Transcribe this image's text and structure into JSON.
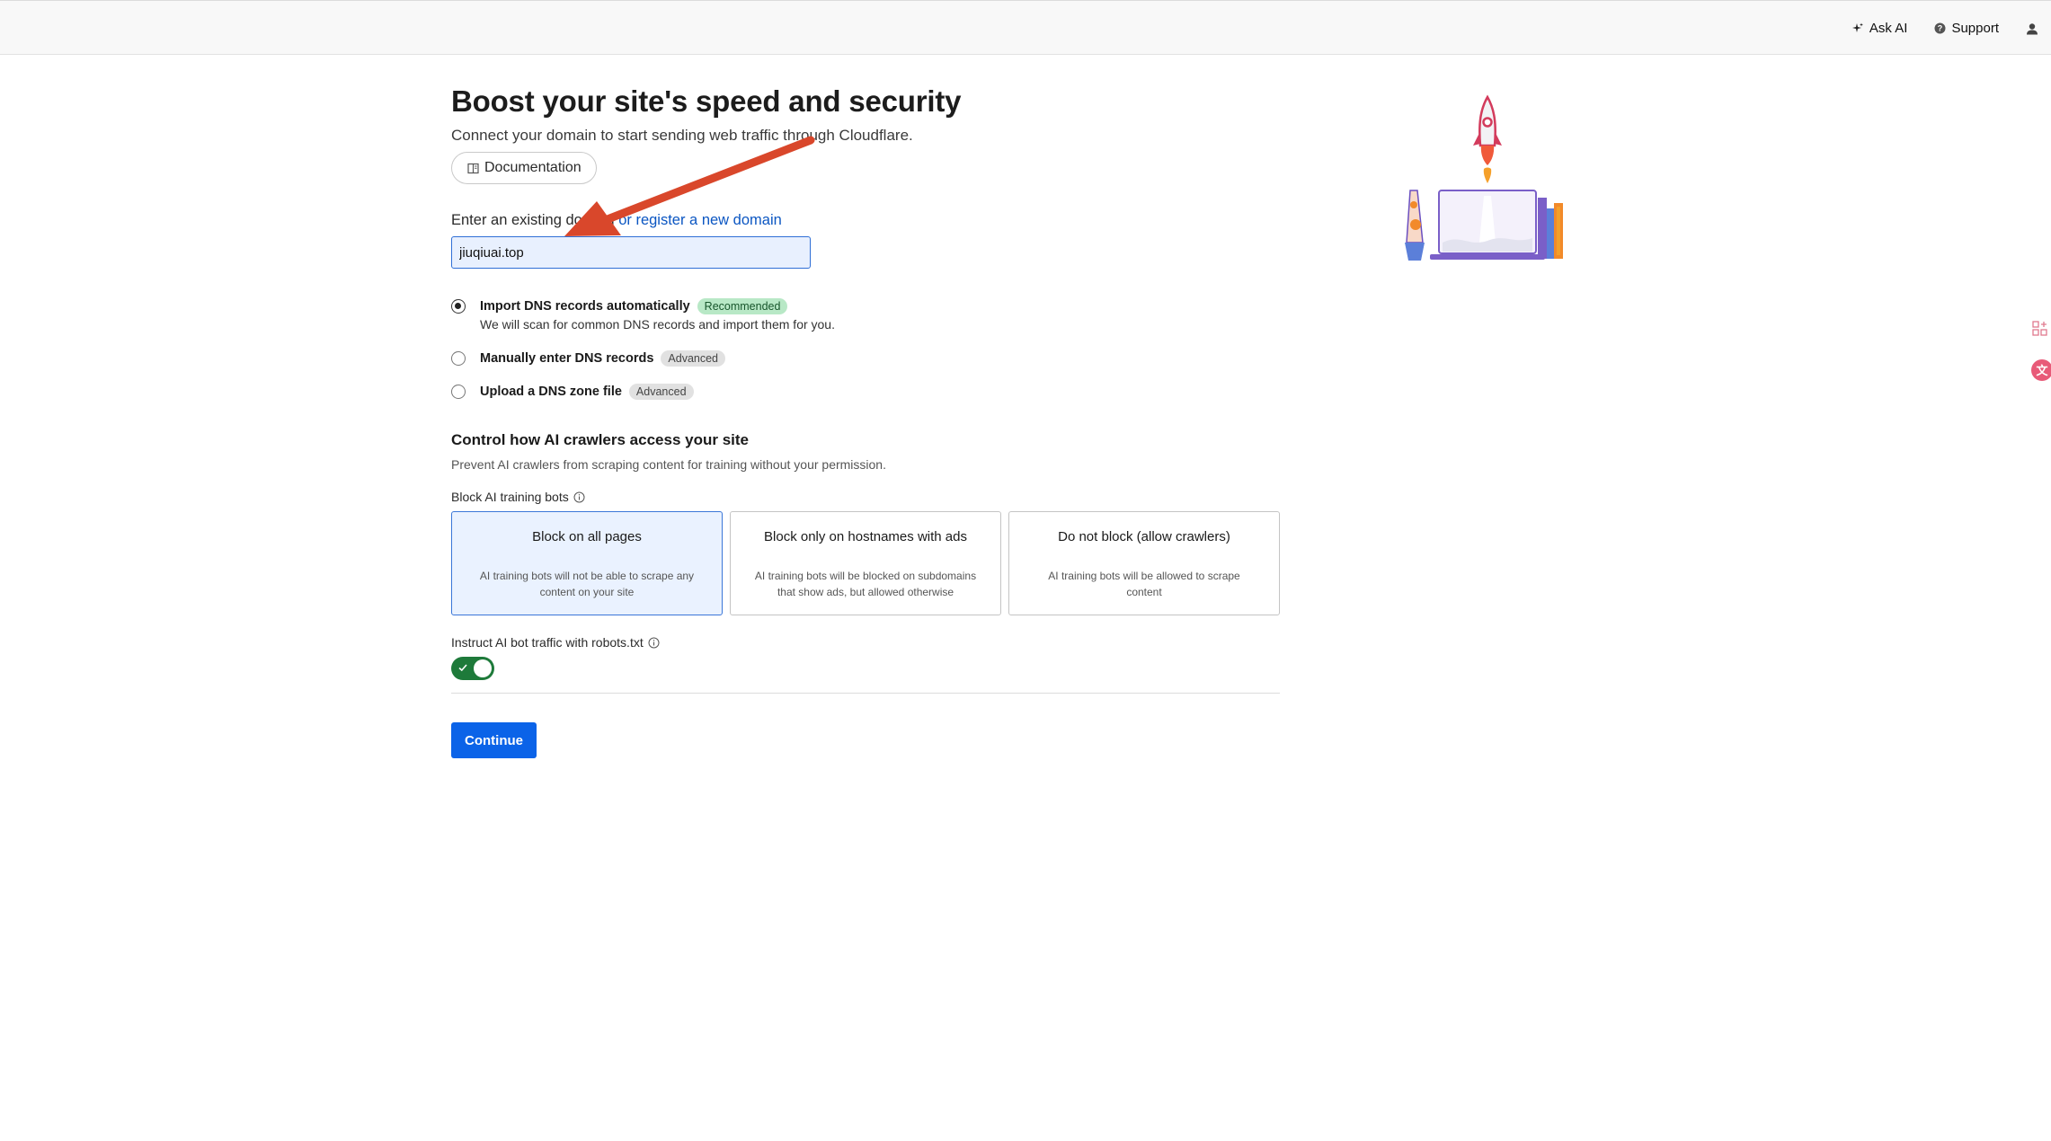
{
  "topbar": {
    "ask_ai": "Ask AI",
    "support": "Support"
  },
  "main": {
    "title": "Boost your site's speed and security",
    "subtitle": "Connect your domain to start sending web traffic through Cloudflare.",
    "documentation_label": "Documentation",
    "domain_label_prefix": "Enter an existing domain",
    "domain_label_link": "or register a new domain",
    "domain_value": "jiuqiuai.top"
  },
  "dns_options": [
    {
      "label": "Import DNS records automatically",
      "badge": "Recommended",
      "checked": true,
      "description": "We will scan for common DNS records and import them for you."
    },
    {
      "label": "Manually enter DNS records",
      "badge": "Advanced",
      "checked": false
    },
    {
      "label": "Upload a DNS zone file",
      "badge": "Advanced",
      "checked": false
    }
  ],
  "ai_section": {
    "title": "Control how AI crawlers access your site",
    "description": "Prevent AI crawlers from scraping content for training without your permission.",
    "block_label": "Block AI training bots",
    "cards": [
      {
        "title": "Block on all pages",
        "description": "AI training bots will not be able to scrape any content on your site",
        "selected": true
      },
      {
        "title": "Block only on hostnames with ads",
        "description": "AI training bots will be blocked on subdomains that show ads, but allowed otherwise",
        "selected": false
      },
      {
        "title": "Do not block (allow crawlers)",
        "description": "AI training bots will be allowed to scrape content",
        "selected": false
      }
    ],
    "robots_label": "Instruct AI bot traffic with robots.txt",
    "robots_enabled": true
  },
  "continue_label": "Continue",
  "colors": {
    "primary": "#0b63e8",
    "toggle_on": "#1e7a3a",
    "link": "#0b56c2",
    "annotation_arrow": "#d9472b",
    "recommended_badge": "#b8e8c6"
  }
}
